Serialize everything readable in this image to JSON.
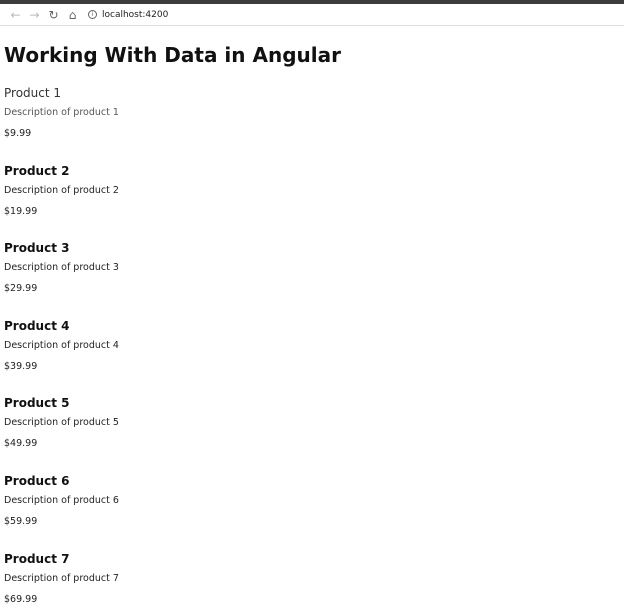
{
  "browser": {
    "url": "localhost:4200",
    "back_icon": "←",
    "forward_icon": "→",
    "reload_icon": "↻",
    "home_icon": "⌂",
    "info_icon": "i"
  },
  "page": {
    "title": "Working With Data in Angular"
  },
  "products": [
    {
      "name": "Product 1",
      "description": "Description of product 1",
      "price": "$9.99"
    },
    {
      "name": "Product 2",
      "description": "Description of product 2",
      "price": "$19.99"
    },
    {
      "name": "Product 3",
      "description": "Description of product 3",
      "price": "$29.99"
    },
    {
      "name": "Product 4",
      "description": "Description of product 4",
      "price": "$39.99"
    },
    {
      "name": "Product 5",
      "description": "Description of product 5",
      "price": "$49.99"
    },
    {
      "name": "Product 6",
      "description": "Description of product 6",
      "price": "$59.99"
    },
    {
      "name": "Product 7",
      "description": "Description of product 7",
      "price": "$69.99"
    }
  ]
}
